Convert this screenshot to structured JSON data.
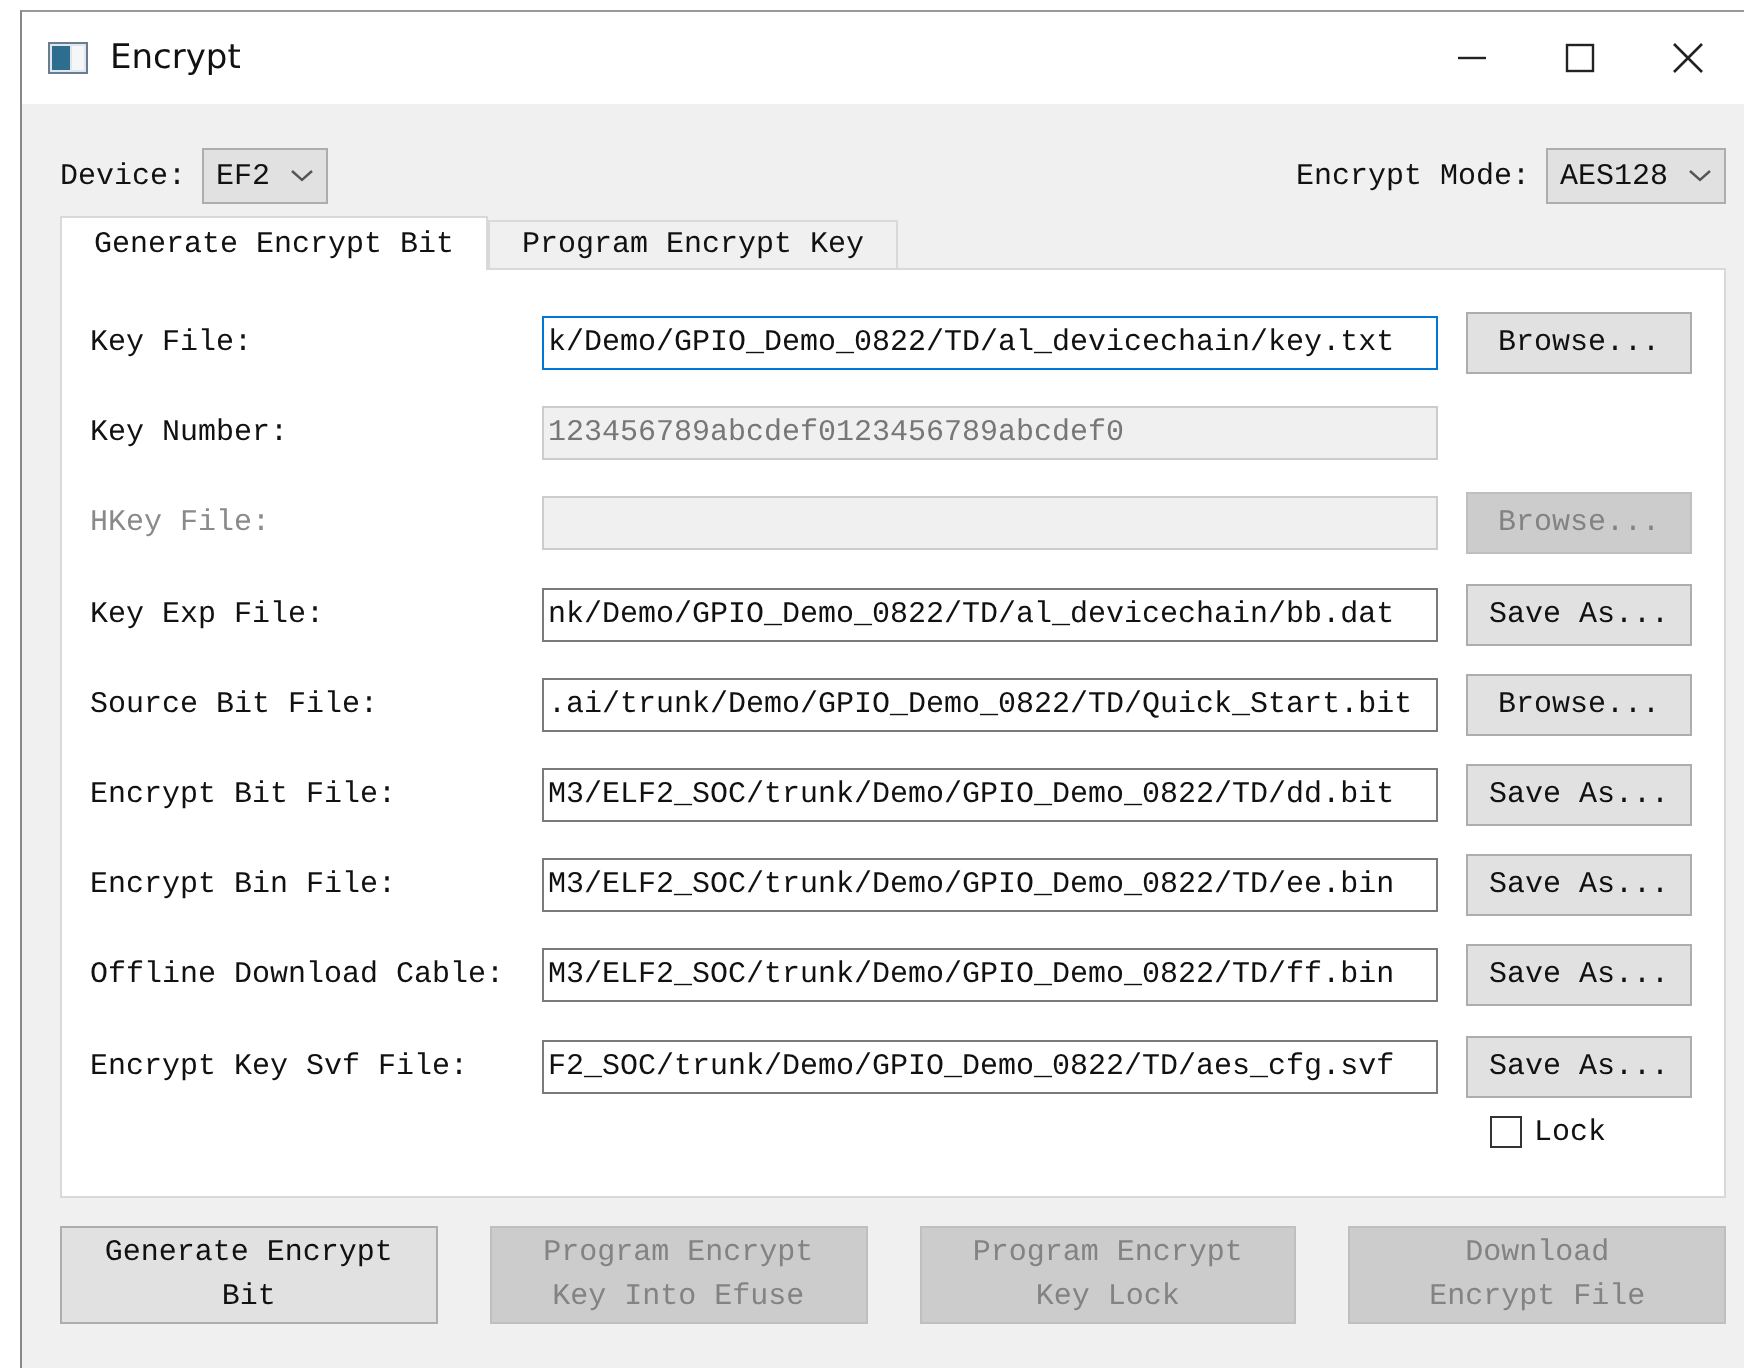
{
  "window": {
    "title": "Encrypt"
  },
  "device": {
    "label": "Device:",
    "value": "EF2"
  },
  "encrypt_mode": {
    "label": "Encrypt Mode:",
    "value": "AES128"
  },
  "tabs": [
    {
      "label": "Generate Encrypt Bit",
      "selected": true
    },
    {
      "label": "Program Encrypt Key",
      "selected": false
    }
  ],
  "rows": [
    {
      "label": "Key File:",
      "value": "k/Demo/GPIO_Demo_0822/TD/al_devicechain/key.txt",
      "focused": true,
      "disabled": false,
      "button": {
        "label": "Browse...",
        "disabled": false
      }
    },
    {
      "label": "Key Number:",
      "value": "123456789abcdef0123456789abcdef0",
      "focused": false,
      "disabled": true
    },
    {
      "label": "HKey File:",
      "label_disabled": true,
      "focused": false,
      "disabled": true,
      "button": {
        "label": "Browse...",
        "disabled": true
      }
    },
    {
      "label": "Key Exp File:",
      "value": "nk/Demo/GPIO_Demo_0822/TD/al_devicechain/bb.dat",
      "focused": false,
      "disabled": false,
      "button": {
        "label": "Save As...",
        "disabled": false
      }
    },
    {
      "label": "Source Bit File:",
      "value": ".ai/trunk/Demo/GPIO_Demo_0822/TD/Quick_Start.bit",
      "focused": false,
      "disabled": false,
      "button": {
        "label": "Browse...",
        "disabled": false
      }
    },
    {
      "label": "Encrypt Bit File:",
      "value": "M3/ELF2_SOC/trunk/Demo/GPIO_Demo_0822/TD/dd.bit",
      "focused": false,
      "disabled": false,
      "button": {
        "label": "Save As...",
        "disabled": false
      }
    },
    {
      "label": "Encrypt Bin File:",
      "value": "M3/ELF2_SOC/trunk/Demo/GPIO_Demo_0822/TD/ee.bin",
      "focused": false,
      "disabled": false,
      "button": {
        "label": "Save As...",
        "disabled": false
      }
    },
    {
      "label": "Offline Download Cable:",
      "value": "M3/ELF2_SOC/trunk/Demo/GPIO_Demo_0822/TD/ff.bin",
      "focused": false,
      "disabled": false,
      "button": {
        "label": "Save As...",
        "disabled": false
      }
    },
    {
      "label": "Encrypt Key Svf File:",
      "value": "F2_SOC/trunk/Demo/GPIO_Demo_0822/TD/aes_cfg.svf",
      "focused": false,
      "disabled": false,
      "button": {
        "label": "Save As...",
        "disabled": false
      }
    }
  ],
  "lock": {
    "label": "Lock",
    "checked": false
  },
  "actions": [
    {
      "lines": [
        "Generate Encrypt",
        "Bit"
      ],
      "disabled": false
    },
    {
      "lines": [
        "Program Encrypt",
        "Key Into Efuse"
      ],
      "disabled": true
    },
    {
      "lines": [
        "Program Encrypt",
        "Key Lock"
      ],
      "disabled": true
    },
    {
      "lines": [
        "Download",
        "Encrypt File"
      ],
      "disabled": true
    }
  ]
}
